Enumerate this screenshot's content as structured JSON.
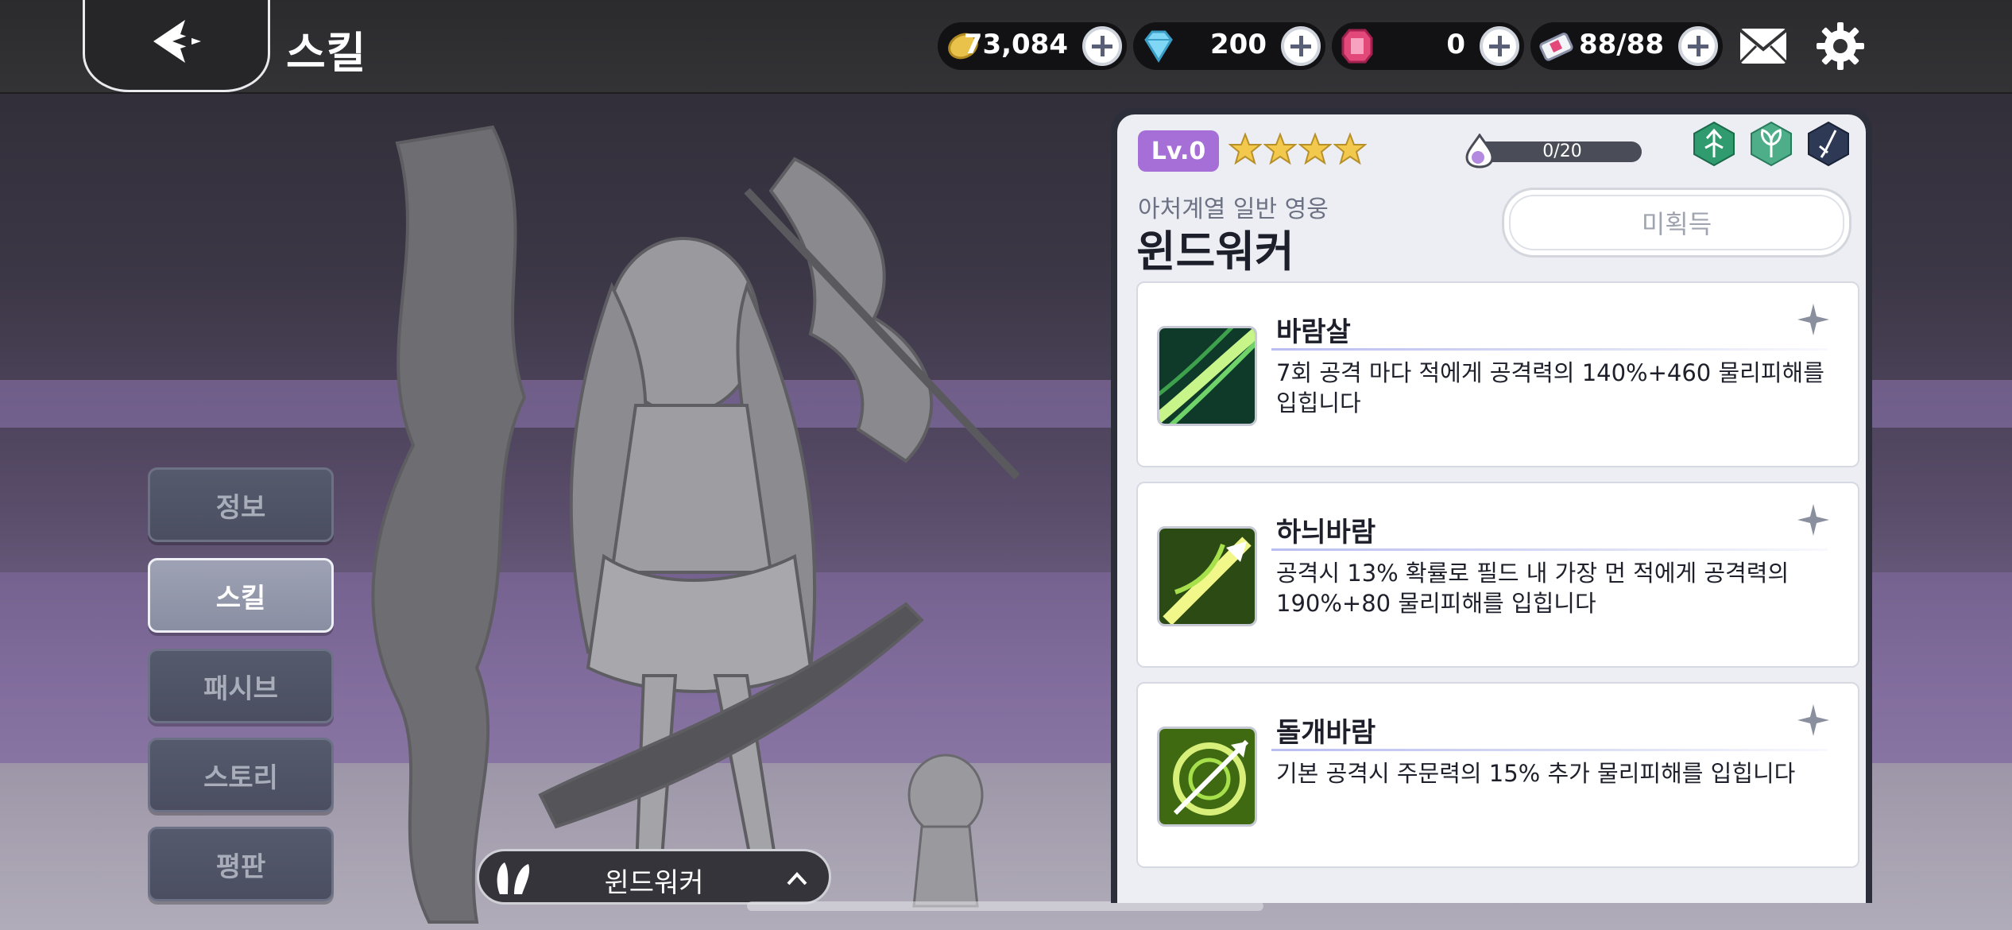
{
  "header": {
    "title": "스킬"
  },
  "currencies": [
    {
      "name": "gold",
      "value": "73,084"
    },
    {
      "name": "diamond",
      "value": "200"
    },
    {
      "name": "ruby",
      "value": "0"
    },
    {
      "name": "stamina",
      "value": "88/88"
    }
  ],
  "tabs": [
    {
      "label": "정보",
      "active": false
    },
    {
      "label": "스킬",
      "active": true
    },
    {
      "label": "패시브",
      "active": false
    },
    {
      "label": "스토리",
      "active": false
    },
    {
      "label": "평판",
      "active": false
    }
  ],
  "character_selector": {
    "name": "윈드워커"
  },
  "hero": {
    "level": "Lv.0",
    "stars": 4,
    "exp": "0/20",
    "subtitle": "아처계열 일반 영웅",
    "name": "윈드워커",
    "acquire_label": "미획득",
    "class_icons": [
      "archer-class-icon",
      "nature-element-icon",
      "sword-role-icon"
    ]
  },
  "skills": [
    {
      "name": "바람살",
      "description": "7회 공격 마다 적에게 공격력의 140%+460 물리피해를 입힙니다"
    },
    {
      "name": "하늬바람",
      "description": "공격시 13% 확률로 필드 내 가장 먼 적에게 공격력의 190%+80 물리피해를 입힙니다"
    },
    {
      "name": "돌개바람",
      "description": "기본 공격시 주문력의 15% 추가 물리피해를 입힙니다"
    }
  ],
  "colors": {
    "level_badge": "#a66fd8",
    "star": "#f2c94c",
    "active_tab": "#9ea2b4"
  }
}
